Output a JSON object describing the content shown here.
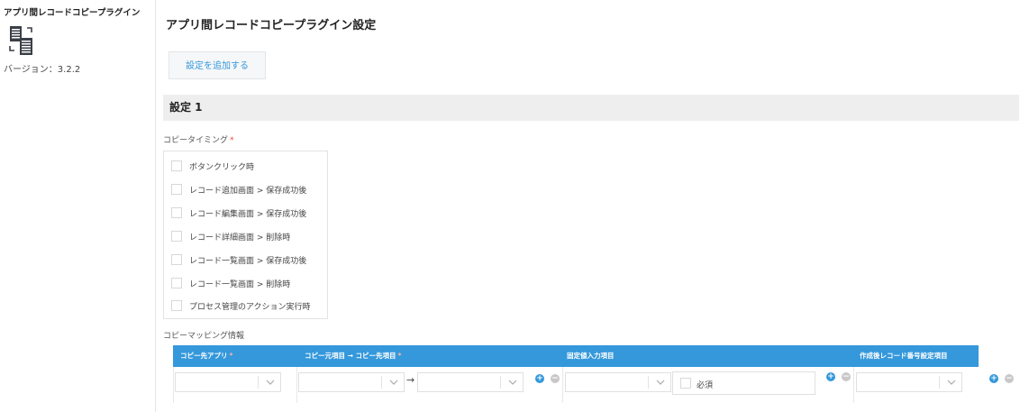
{
  "sidebar": {
    "title": "アプリ間レコードコピープラグイン",
    "icon": "copy-documents-icon",
    "version": "バージョン：3.2.2"
  },
  "main": {
    "title": "アプリ間レコードコピープラグイン設定",
    "add_button": "設定を追加する",
    "setting_title": "設定 1",
    "timing_label": "コピータイミング",
    "required_mark": "*",
    "timing_options": [
      "ボタンクリック時",
      "レコード追加画面 > 保存成功後",
      "レコード編集画面 > 保存成功後",
      "レコード詳細画面 > 削除時",
      "レコード一覧画面 > 保存成功後",
      "レコード一覧画面 > 削除時",
      "プロセス管理のアクション実行時"
    ],
    "mapping_label": "コピーマッピング情報",
    "mapping_headers": {
      "dest_app": "コピー先アプリ",
      "src_to_dest": "コピー元項目 → コピー先項目",
      "fixed_value": "固定値入力項目",
      "record_number": "作成後レコード番号設定項目"
    },
    "arrow": "→",
    "required_checkbox": "必須",
    "plus_glyph": "+",
    "minus_glyph": "−"
  },
  "colors": {
    "accent": "#3498db",
    "required": "#e74c3c",
    "minus": "#c8c8c8"
  }
}
